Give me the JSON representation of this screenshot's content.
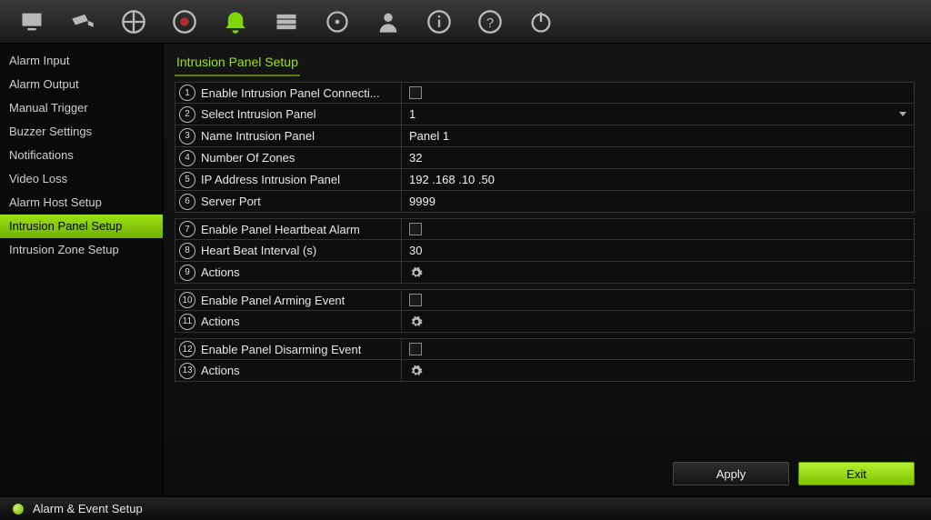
{
  "toolbar_icons": [
    "monitor",
    "camera",
    "grid",
    "record",
    "alarm",
    "storage",
    "hdd",
    "user",
    "info",
    "help",
    "power"
  ],
  "active_toolbar_index": 4,
  "sidebar": {
    "items": [
      {
        "label": "Alarm Input"
      },
      {
        "label": "Alarm Output"
      },
      {
        "label": "Manual Trigger"
      },
      {
        "label": "Buzzer Settings"
      },
      {
        "label": "Notifications"
      },
      {
        "label": "Video Loss"
      },
      {
        "label": "Alarm Host Setup"
      },
      {
        "label": "Intrusion Panel Setup"
      },
      {
        "label": "Intrusion Zone Setup"
      }
    ],
    "active_index": 7
  },
  "main": {
    "title": "Intrusion Panel Setup",
    "rows": [
      {
        "n": "1",
        "label": "Enable Intrusion Panel Connecti...",
        "type": "checkbox"
      },
      {
        "n": "2",
        "label": "Select Intrusion Panel",
        "type": "select",
        "value": "1"
      },
      {
        "n": "3",
        "label": "Name Intrusion Panel",
        "type": "text",
        "value": "Panel 1"
      },
      {
        "n": "4",
        "label": "Number Of Zones",
        "type": "text",
        "value": "32"
      },
      {
        "n": "5",
        "label": "IP Address Intrusion Panel",
        "type": "text",
        "value": "192 .168 .10   .50"
      },
      {
        "n": "6",
        "label": "Server Port",
        "type": "text",
        "value": "9999"
      },
      {
        "n": "7",
        "label": "Enable Panel Heartbeat Alarm",
        "type": "checkbox"
      },
      {
        "n": "8",
        "label": "Heart Beat Interval (s)",
        "type": "text",
        "value": "30"
      },
      {
        "n": "9",
        "label": "Actions",
        "type": "gear"
      },
      {
        "n": "10",
        "label": "Enable Panel Arming Event",
        "type": "checkbox"
      },
      {
        "n": "11",
        "label": "Actions",
        "type": "gear"
      },
      {
        "n": "12",
        "label": "Enable Panel Disarming Event",
        "type": "checkbox"
      },
      {
        "n": "13",
        "label": "Actions",
        "type": "gear"
      }
    ],
    "groups": [
      [
        0,
        1,
        2,
        3,
        4,
        5
      ],
      [
        6,
        7,
        8
      ],
      [
        9,
        10
      ],
      [
        11,
        12
      ]
    ]
  },
  "buttons": {
    "apply": "Apply",
    "exit": "Exit"
  },
  "footer": {
    "label": "Alarm & Event Setup"
  }
}
